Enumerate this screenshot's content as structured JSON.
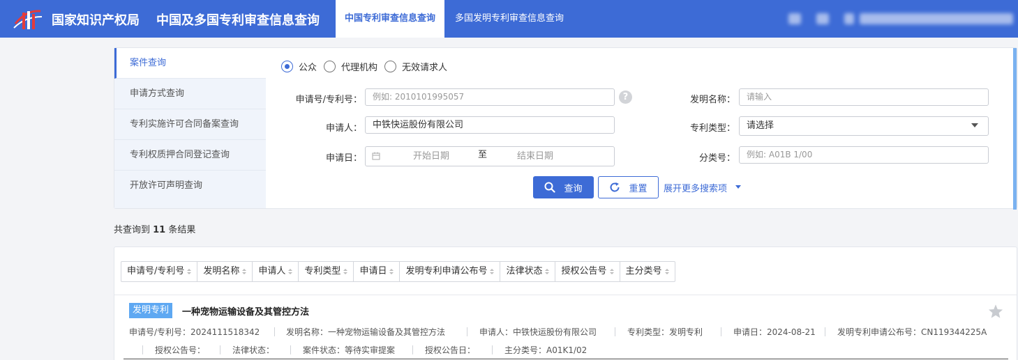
{
  "header": {
    "brand_agency": "国家知识产权局",
    "brand_system": "中国及多国专利审查信息查询",
    "tabs": [
      {
        "label": "中国专利审查信息查询",
        "active": true
      },
      {
        "label": "多国发明专利审查信息查询",
        "active": false
      }
    ],
    "colors": {
      "bar": "#3d6bd6",
      "accent": "#3d6bd6"
    }
  },
  "sidebar": {
    "items": [
      {
        "label": "案件查询",
        "active": true
      },
      {
        "label": "申请方式查询",
        "active": false
      },
      {
        "label": "专利实施许可合同备案查询",
        "active": false
      },
      {
        "label": "专利权质押合同登记查询",
        "active": false
      },
      {
        "label": "开放许可声明查询",
        "active": false
      }
    ]
  },
  "search": {
    "user_types": [
      {
        "label": "公众",
        "checked": true
      },
      {
        "label": "代理机构",
        "checked": false
      },
      {
        "label": "无效请求人",
        "checked": false
      }
    ],
    "application_no_label": "申请号/专利号：",
    "application_no_placeholder": "例如: 2010101995057",
    "help_icon": "?",
    "applicant_label": "申请人：",
    "applicant_value": "中铁快运股份有限公司",
    "date_label": "申请日：",
    "date_start_placeholder": "开始日期",
    "date_to": "至",
    "date_end_placeholder": "结束日期",
    "invention_name_label": "发明名称：",
    "invention_name_placeholder": "请输入",
    "patent_type_label": "专利类型：",
    "patent_type_value": "请选择",
    "class_no_label": "分类号：",
    "class_no_placeholder": "例如: A01B 1/00",
    "query_button": "查询",
    "reset_button": "重置",
    "expand_link": "展开更多搜索项"
  },
  "summary": {
    "prefix": "共查询到 ",
    "count": "11",
    "suffix": " 条结果"
  },
  "sort_fields": [
    "申请号/专利号",
    "发明名称",
    "申请人",
    "专利类型",
    "申请日",
    "发明专利申请公布号",
    "法律状态",
    "授权公告号",
    "主分类号"
  ],
  "result": {
    "tag": "发明专利",
    "title": "一种宠物运输设备及其管控方法",
    "line1": [
      "申请号/专利号：2024111518342",
      "发明名称：一种宠物运输设备及其管控方法",
      "申请人：中铁快运股份有限公司",
      "专利类型：发明专利",
      "申请日：2024-08-21",
      "发明专利申请公布号：CN119344225A"
    ],
    "line2": [
      "授权公告号：",
      "法律状态：",
      "案件状态：等待实审提案",
      "授权公告日：",
      "主分类号：A01K1/02"
    ]
  }
}
